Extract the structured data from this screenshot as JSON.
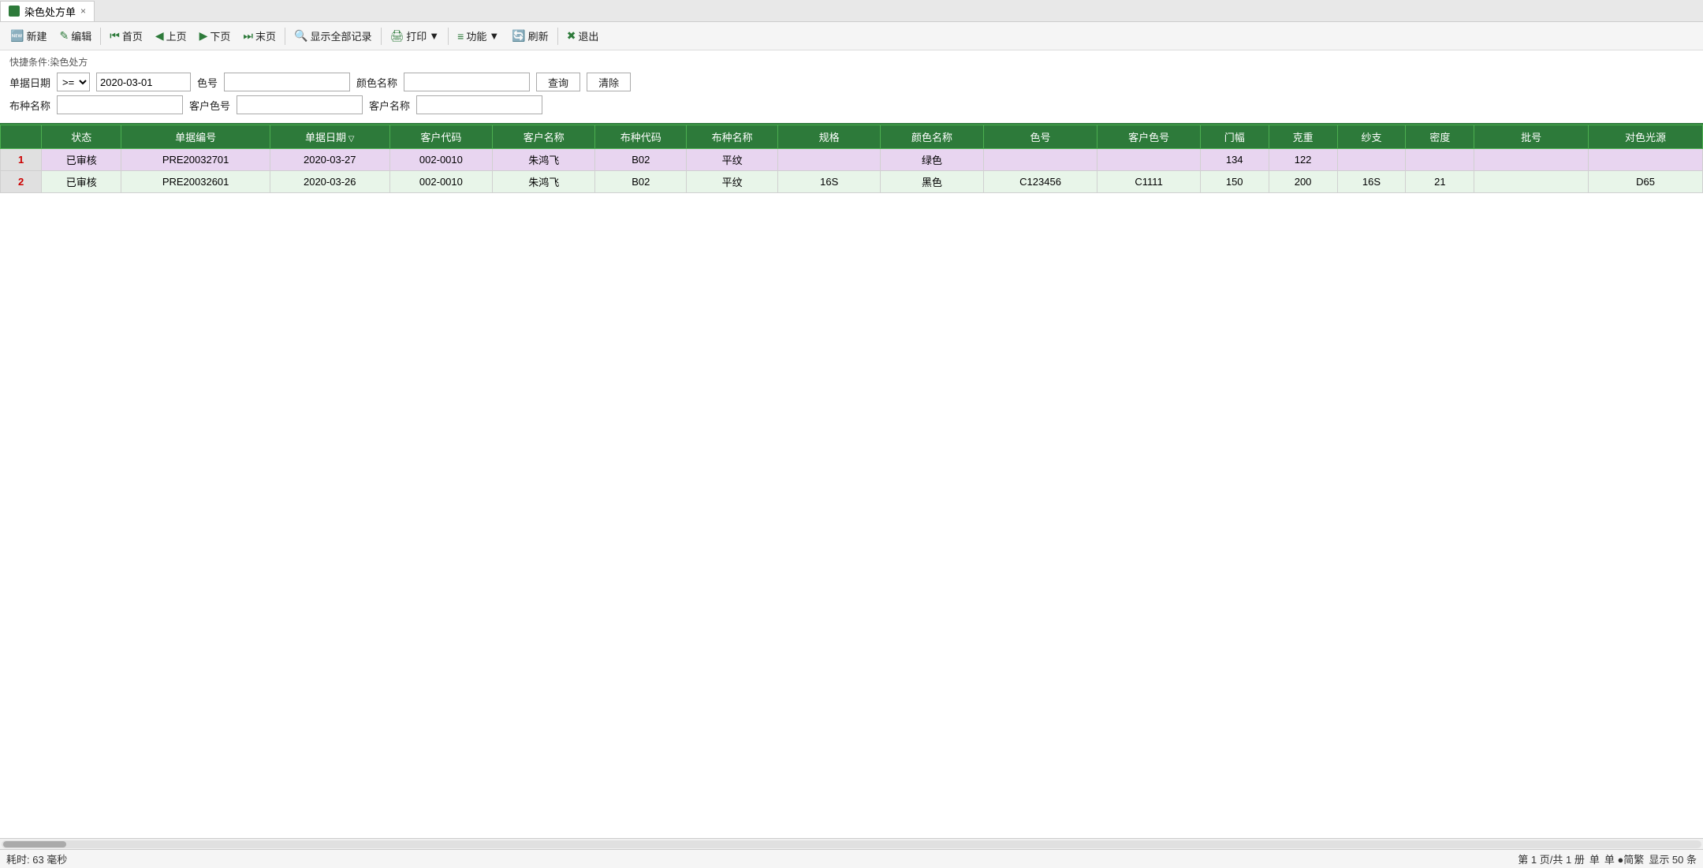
{
  "titleBar": {
    "tabLabel": "染色处方单",
    "closeLabel": "×"
  },
  "toolbar": {
    "buttons": [
      {
        "id": "new",
        "icon": "➕",
        "label": "新建"
      },
      {
        "id": "edit",
        "icon": "✏️",
        "label": "编辑"
      },
      {
        "id": "first",
        "icon": "⏮",
        "label": "首页"
      },
      {
        "id": "prev",
        "icon": "◀",
        "label": "上页"
      },
      {
        "id": "next",
        "icon": "▶",
        "label": "下页"
      },
      {
        "id": "last",
        "icon": "⏭",
        "label": "末页"
      },
      {
        "id": "showAll",
        "icon": "🔍",
        "label": "显示全部记录"
      },
      {
        "id": "print",
        "icon": "🖨",
        "label": "打印"
      },
      {
        "id": "func",
        "icon": "≡",
        "label": "功能"
      },
      {
        "id": "refresh",
        "icon": "🔄",
        "label": "刷新"
      },
      {
        "id": "exit",
        "icon": "✖",
        "label": "退出"
      }
    ]
  },
  "quickFilter": {
    "title": "快捷条件:染色处方",
    "fields": {
      "dateLabel": "单据日期",
      "dateOp": ">=",
      "dateOpOptions": [
        ">=",
        "<=",
        "=",
        ">",
        "<"
      ],
      "dateValue": "2020-03-01",
      "colorCodeLabel": "色号",
      "colorCodeValue": "",
      "colorNameLabel": "颜色名称",
      "colorNameValue": "",
      "fabricNameLabel": "布种名称",
      "fabricNameValue": "",
      "customerCodeLabel": "客户色号",
      "customerCodeValue": "",
      "customerNameLabel": "客户名称",
      "customerNameValue": "",
      "queryBtn": "查询",
      "clearBtn": "清除"
    }
  },
  "table": {
    "columns": [
      {
        "id": "idx",
        "label": ""
      },
      {
        "id": "status",
        "label": "状态"
      },
      {
        "id": "orderNo",
        "label": "单据编号"
      },
      {
        "id": "orderDate",
        "label": "单据日期",
        "sortable": true
      },
      {
        "id": "customerCode",
        "label": "客户代码"
      },
      {
        "id": "customerName",
        "label": "客户名称"
      },
      {
        "id": "fabricCode",
        "label": "布种代码"
      },
      {
        "id": "fabricName",
        "label": "布种名称"
      },
      {
        "id": "spec",
        "label": "规格"
      },
      {
        "id": "colorName",
        "label": "颜色名称"
      },
      {
        "id": "colorCode",
        "label": "色号"
      },
      {
        "id": "customerColorCode",
        "label": "客户色号"
      },
      {
        "id": "doorWidth",
        "label": "门幅"
      },
      {
        "id": "weight",
        "label": "克重"
      },
      {
        "id": "yarnCount",
        "label": "纱支"
      },
      {
        "id": "density",
        "label": "密度"
      },
      {
        "id": "batchNo",
        "label": "批号"
      },
      {
        "id": "colorSource",
        "label": "对色光源"
      }
    ],
    "rows": [
      {
        "idx": "1",
        "status": "已审核",
        "orderNo": "PRE20032701",
        "orderDate": "2020-03-27",
        "customerCode": "002-0010",
        "customerName": "朱鸿飞",
        "fabricCode": "B02",
        "fabricName": "平纹",
        "spec": "",
        "colorName": "绿色",
        "colorCode": "",
        "customerColorCode": "",
        "doorWidth": "134",
        "weight": "122",
        "yarnCount": "",
        "density": "",
        "batchNo": "",
        "colorSource": ""
      },
      {
        "idx": "2",
        "status": "已审核",
        "orderNo": "PRE20032601",
        "orderDate": "2020-03-26",
        "customerCode": "002-0010",
        "customerName": "朱鸿飞",
        "fabricCode": "B02",
        "fabricName": "平纹",
        "spec": "16S",
        "colorName": "黑色",
        "colorCode": "C123456",
        "customerColorCode": "C1111",
        "doorWidth": "150",
        "weight": "200",
        "yarnCount": "16S",
        "density": "21",
        "batchNo": "",
        "colorSource": "D65"
      }
    ]
  },
  "statusBar": {
    "leftText": "耗时: 63 毫秒",
    "pageInfo": "第 1 页/共 1 册",
    "editMode": "单",
    "displayMode": "简繁",
    "recordCount": "显示 50 条"
  }
}
